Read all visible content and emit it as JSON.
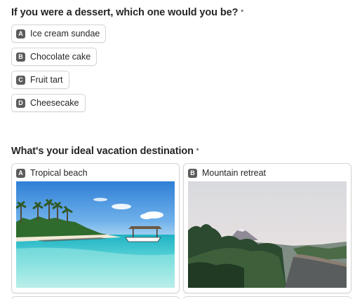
{
  "q1": {
    "title": "If you were a dessert, which one would you be?",
    "required_mark": "*",
    "options": [
      {
        "key": "A",
        "label": "Ice cream sundae"
      },
      {
        "key": "B",
        "label": "Chocolate cake"
      },
      {
        "key": "C",
        "label": "Fruit tart"
      },
      {
        "key": "D",
        "label": "Cheesecake"
      }
    ]
  },
  "q2": {
    "title": "What's your ideal vacation destination",
    "required_mark": "*",
    "options": [
      {
        "key": "A",
        "label": "Tropical beach",
        "image": "tropical-beach-photo"
      },
      {
        "key": "B",
        "label": "Mountain retreat",
        "image": "mountain-retreat-photo"
      }
    ]
  }
}
